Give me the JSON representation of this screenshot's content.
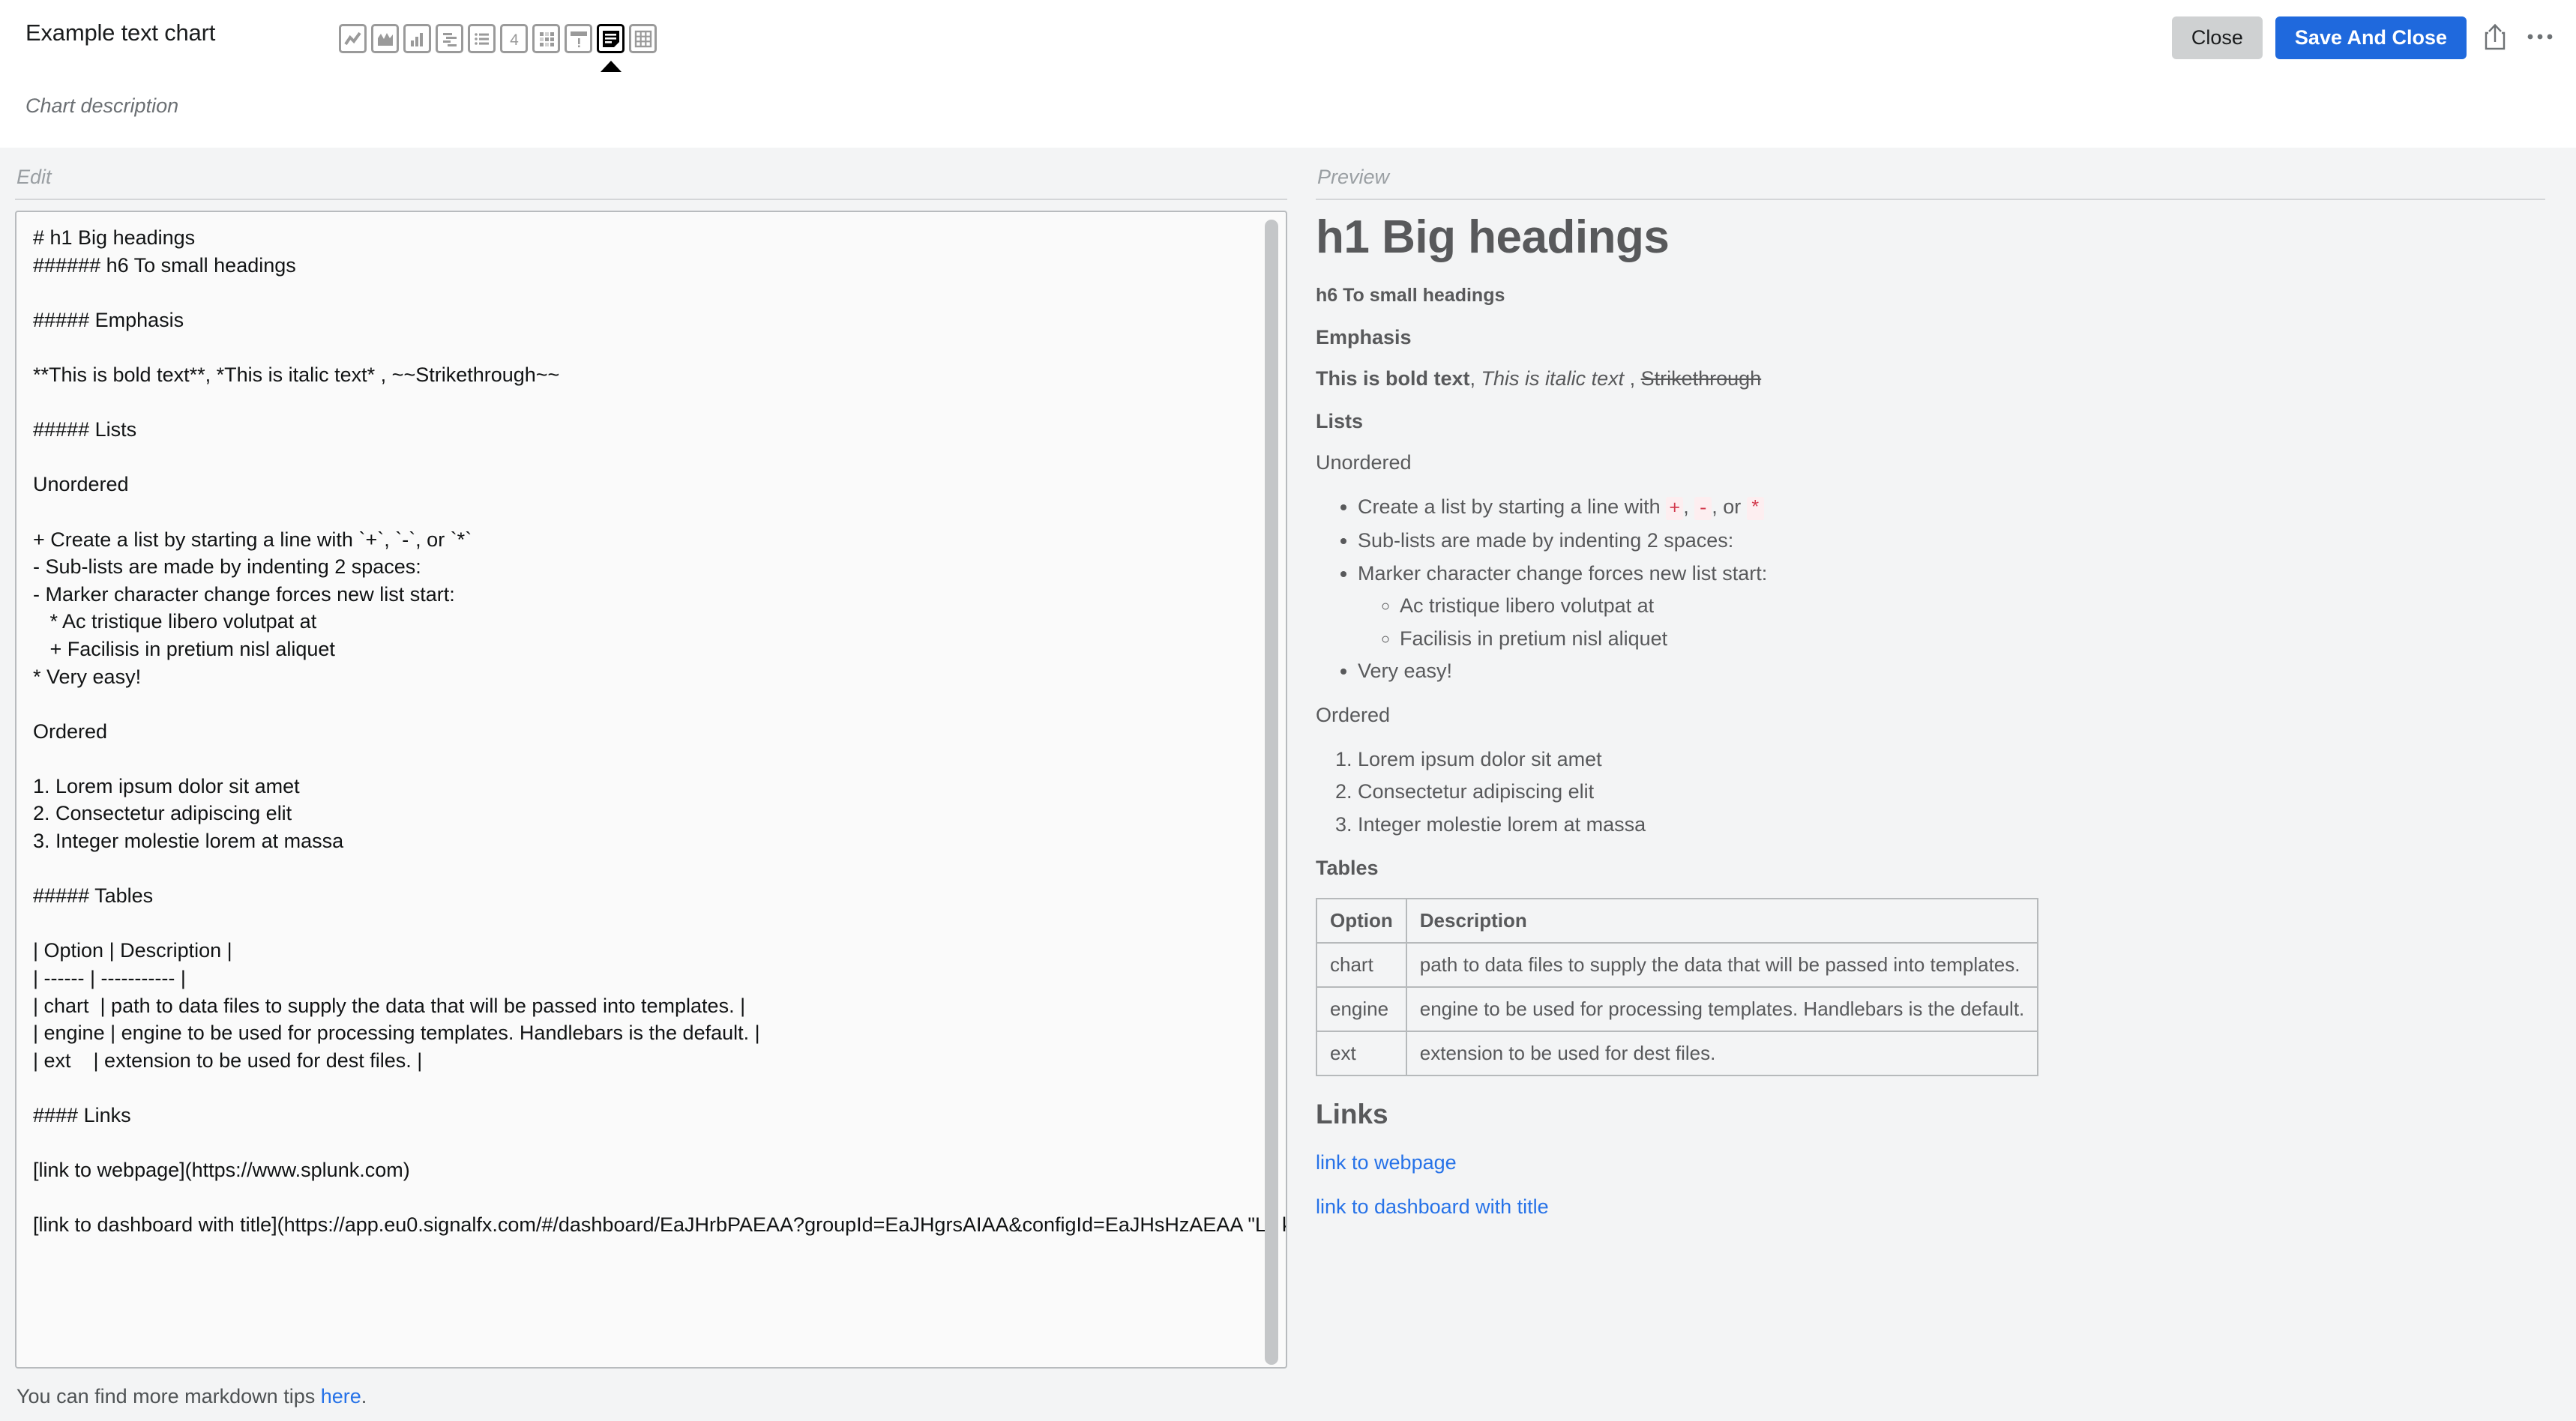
{
  "header": {
    "title": "Example text chart",
    "description": "Chart description",
    "close_label": "Close",
    "save_label": "Save And Close",
    "share_icon": "share-icon",
    "more_icon": "ellipsis-icon"
  },
  "chart_types": [
    {
      "name": "line-chart-type",
      "icon": "line-chart-icon",
      "selected": false
    },
    {
      "name": "area-chart-type",
      "icon": "area-chart-icon",
      "selected": false
    },
    {
      "name": "column-chart-type",
      "icon": "column-chart-icon",
      "selected": false
    },
    {
      "name": "histogram-chart-type",
      "icon": "histogram-chart-icon",
      "selected": false
    },
    {
      "name": "list-chart-type",
      "icon": "list-chart-icon",
      "selected": false
    },
    {
      "name": "single-value-chart-type",
      "icon": "single-value-icon",
      "label": "4",
      "selected": false
    },
    {
      "name": "heatmap-chart-type",
      "icon": "heatmap-icon",
      "selected": false
    },
    {
      "name": "event-feed-chart-type",
      "icon": "alert-icon",
      "selected": false
    },
    {
      "name": "text-chart-type",
      "icon": "text-note-icon",
      "selected": true
    },
    {
      "name": "table-chart-type",
      "icon": "table-grid-icon",
      "selected": false
    }
  ],
  "panes": {
    "edit_label": "Edit",
    "preview_label": "Preview"
  },
  "editor": {
    "content": "# h1 Big headings\n###### h6 To small headings\n\n##### Emphasis\n\n**This is bold text**, *This is italic text* , ~~Strikethrough~~\n\n##### Lists\n\nUnordered\n\n+ Create a list by starting a line with `+`, `-`, or `*`\n- Sub-lists are made by indenting 2 spaces:\n- Marker character change forces new list start:\n   * Ac tristique libero volutpat at\n   + Facilisis in pretium nisl aliquet\n* Very easy!\n\nOrdered\n\n1. Lorem ipsum dolor sit amet\n2. Consectetur adipiscing elit\n3. Integer molestie lorem at massa\n\n##### Tables\n\n| Option | Description |\n| ------ | ----------- |\n| chart  | path to data files to supply the data that will be passed into templates. |\n| engine | engine to be used for processing templates. Handlebars is the default. |\n| ext    | extension to be used for dest files. |\n\n#### Links\n\n[link to webpage](https://www.splunk.com)\n\n[link to dashboard with title](https://app.eu0.signalfx.com/#/dashboard/EaJHrbPAEAA?groupId=EaJHgrsAIAA&configId=EaJHsHzAEAA \"Link to the Sample chart Dashboard!\")"
  },
  "tips": {
    "text_before": "You can find more markdown tips ",
    "link_label": "here",
    "text_after": "."
  },
  "preview": {
    "h1": "h1 Big headings",
    "h6": "h6 To small headings",
    "emphasis_heading": "Emphasis",
    "emphasis_bold": "This is bold text",
    "emphasis_sep1": ", ",
    "emphasis_italic": "This is italic text",
    "emphasis_sep2": " , ",
    "emphasis_strike": "Strikethrough",
    "lists_heading": "Lists",
    "unordered_label": "Unordered",
    "ul_item1_pre": "Create a list by starting a line with ",
    "ul_item1_code1": "+",
    "ul_item1_mid1": ", ",
    "ul_item1_code2": "-",
    "ul_item1_mid2": ", or ",
    "ul_item1_code3": "*",
    "ul_item2": "Sub-lists are made by indenting 2 spaces:",
    "ul_item3": "Marker character change forces new list start:",
    "ul_sub1": "Ac tristique libero volutpat at",
    "ul_sub2": "Facilisis in pretium nisl aliquet",
    "ul_item4": "Very easy!",
    "ordered_label": "Ordered",
    "ol_item1": "Lorem ipsum dolor sit amet",
    "ol_item2": "Consectetur adipiscing elit",
    "ol_item3": "Integer molestie lorem at massa",
    "tables_heading": "Tables",
    "table": {
      "headers": [
        "Option",
        "Description"
      ],
      "rows": [
        [
          "chart",
          "path to data files to supply the data that will be passed into templates."
        ],
        [
          "engine",
          "engine to be used for processing templates. Handlebars is the default."
        ],
        [
          "ext",
          "extension to be used for dest files."
        ]
      ]
    },
    "links_heading": "Links",
    "link1": "link to webpage",
    "link2": "link to dashboard with title"
  },
  "colors": {
    "accent_blue": "#1f69dd",
    "link_blue": "#2672e8",
    "inline_code_red": "#d23b4e",
    "inline_code_bg": "#fdeef0",
    "pane_bg": "#f3f4f5",
    "editor_bg": "#fafafa",
    "close_btn_bg": "#cfd1d2"
  }
}
